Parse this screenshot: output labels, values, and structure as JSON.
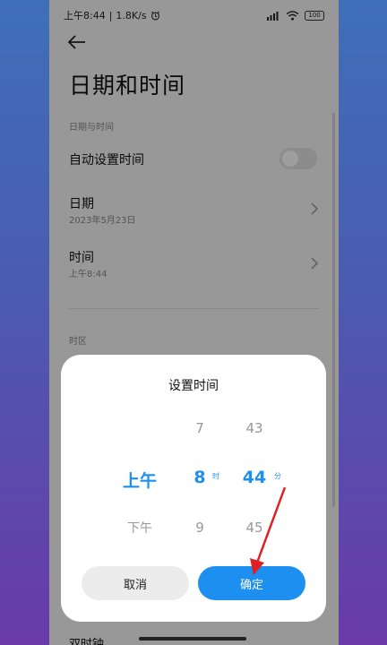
{
  "status": {
    "time": "上午8:44",
    "speed": "1.8K/s",
    "battery": "100"
  },
  "page": {
    "title": "日期和时间",
    "section_datetime": "日期与时间",
    "auto_time_label": "自动设置时间",
    "date_label": "日期",
    "date_value": "2023年5月23日",
    "time_label": "时间",
    "time_value": "上午8:44",
    "section_timezone": "时区",
    "bottom_peek": "双时钟"
  },
  "dialog": {
    "title": "设置时间",
    "ampm": {
      "above": "",
      "selected": "上午",
      "below": "下午"
    },
    "hour": {
      "above": "7",
      "selected": "8",
      "below": "9",
      "unit": "时"
    },
    "minute": {
      "above": "43",
      "selected": "44",
      "below": "45",
      "unit": "分"
    },
    "cancel_label": "取消",
    "confirm_label": "确定"
  },
  "colors": {
    "accent": "#1d8ff0",
    "annotation_arrow": "#e02020"
  }
}
